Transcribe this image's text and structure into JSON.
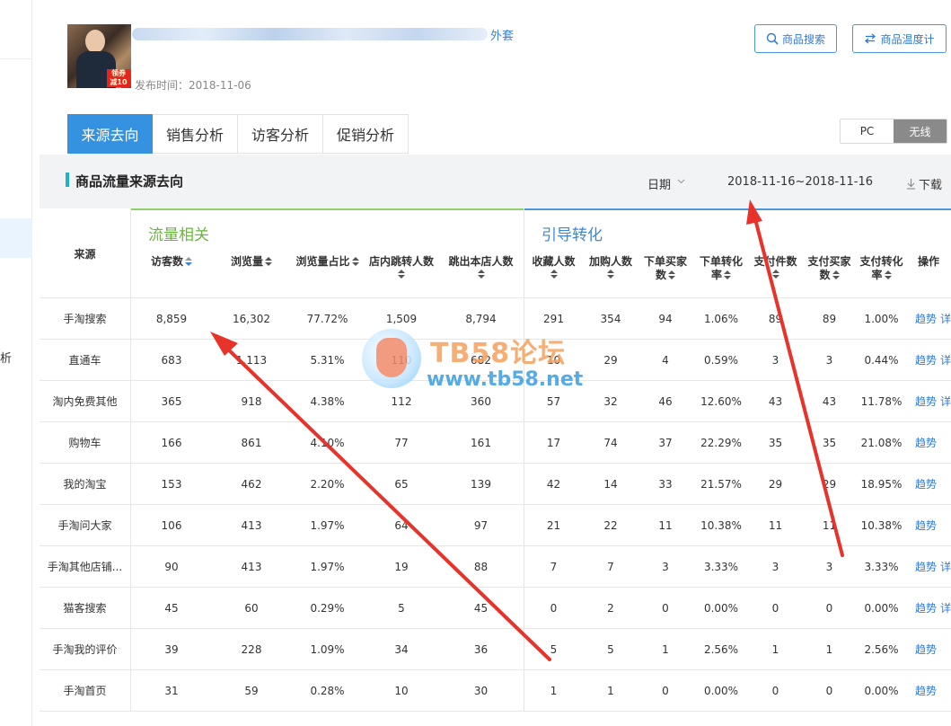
{
  "left_strip": {
    "side_char": "析"
  },
  "product": {
    "title_suffix": "外套",
    "published": "发布时间：2018-11-06",
    "thumb_tag": "领券 减10元"
  },
  "header_buttons": {
    "search": "商品搜索",
    "temperature": "商品温度计"
  },
  "tabs": [
    {
      "label": "来源去向",
      "active": true
    },
    {
      "label": "销售分析",
      "active": false
    },
    {
      "label": "访客分析",
      "active": false
    },
    {
      "label": "促销分析",
      "active": false
    }
  ],
  "device_toggle": {
    "pc": "PC",
    "wireless": "无线",
    "selected": "无线"
  },
  "section": {
    "title": "商品流量来源去向",
    "date_label": "日期",
    "date_range": "2018-11-16~2018-11-16",
    "download": "下载"
  },
  "table": {
    "source_header": "来源",
    "group1": "流量相关",
    "group2": "引导转化",
    "columns": [
      {
        "line1": "访客数",
        "line2": ""
      },
      {
        "line1": "浏览量",
        "line2": ""
      },
      {
        "line1": "浏览量占比",
        "line2": ""
      },
      {
        "line1": "店内跳转人数",
        "line2": ""
      },
      {
        "line1": "跳出本店人数",
        "line2": ""
      },
      {
        "line1": "收藏人数",
        "line2": ""
      },
      {
        "line1": "加购人数",
        "line2": ""
      },
      {
        "line1": "下单买家",
        "line2": "数"
      },
      {
        "line1": "下单转化",
        "line2": "率"
      },
      {
        "line1": "支付件数",
        "line2": ""
      },
      {
        "line1": "支付买家",
        "line2": "数"
      },
      {
        "line1": "支付转化",
        "line2": "率"
      },
      {
        "line1": "操作",
        "line2": ""
      }
    ],
    "rows": [
      {
        "source": "手淘搜索",
        "values": [
          "8,859",
          "16,302",
          "77.72%",
          "1,509",
          "8,794",
          "291",
          "354",
          "94",
          "1.06%",
          "89",
          "89",
          "1.00%"
        ],
        "actions": [
          "趋势",
          "详"
        ]
      },
      {
        "source": "直通车",
        "values": [
          "683",
          "1,113",
          "5.31%",
          "110",
          "682",
          "10",
          "29",
          "4",
          "0.59%",
          "3",
          "3",
          "0.44%"
        ],
        "actions": [
          "趋势",
          "详"
        ]
      },
      {
        "source": "淘内免费其他",
        "values": [
          "365",
          "918",
          "4.38%",
          "112",
          "360",
          "57",
          "32",
          "46",
          "12.60%",
          "43",
          "43",
          "11.78%"
        ],
        "actions": [
          "趋势",
          "详"
        ]
      },
      {
        "source": "购物车",
        "values": [
          "166",
          "861",
          "4.10%",
          "77",
          "161",
          "17",
          "74",
          "37",
          "22.29%",
          "35",
          "35",
          "21.08%"
        ],
        "actions": [
          "趋势",
          ""
        ]
      },
      {
        "source": "我的淘宝",
        "values": [
          "153",
          "462",
          "2.20%",
          "65",
          "139",
          "42",
          "14",
          "33",
          "21.57%",
          "29",
          "29",
          "18.95%"
        ],
        "actions": [
          "趋势",
          ""
        ]
      },
      {
        "source": "手淘问大家",
        "values": [
          "106",
          "413",
          "1.97%",
          "64",
          "97",
          "21",
          "22",
          "11",
          "10.38%",
          "11",
          "11",
          "10.38%"
        ],
        "actions": [
          "趋势",
          ""
        ]
      },
      {
        "source": "手淘其他店铺...",
        "values": [
          "90",
          "413",
          "1.97%",
          "19",
          "88",
          "7",
          "7",
          "3",
          "3.33%",
          "3",
          "3",
          "3.33%"
        ],
        "actions": [
          "趋势",
          "详"
        ]
      },
      {
        "source": "猫客搜索",
        "values": [
          "45",
          "60",
          "0.29%",
          "5",
          "45",
          "0",
          "2",
          "0",
          "0.00%",
          "0",
          "0",
          "0.00%"
        ],
        "actions": [
          "趋势",
          "详"
        ]
      },
      {
        "source": "手淘我的评价",
        "values": [
          "39",
          "228",
          "1.09%",
          "34",
          "36",
          "5",
          "5",
          "1",
          "2.56%",
          "1",
          "1",
          "2.56%"
        ],
        "actions": [
          "趋势",
          ""
        ]
      },
      {
        "source": "手淘首页",
        "values": [
          "31",
          "59",
          "0.28%",
          "10",
          "30",
          "1",
          "1",
          "0",
          "0.00%",
          "0",
          "0",
          "0.00%"
        ],
        "actions": [
          "趋势",
          ""
        ]
      }
    ]
  },
  "watermark": {
    "brand": "TB58论坛",
    "url": "www.tb58.net"
  },
  "colors": {
    "accent": "#3592e0",
    "group1": "#6ab53c",
    "group2": "#3b86d8",
    "link": "#2e7ad1",
    "arrow": "#e8332a"
  }
}
